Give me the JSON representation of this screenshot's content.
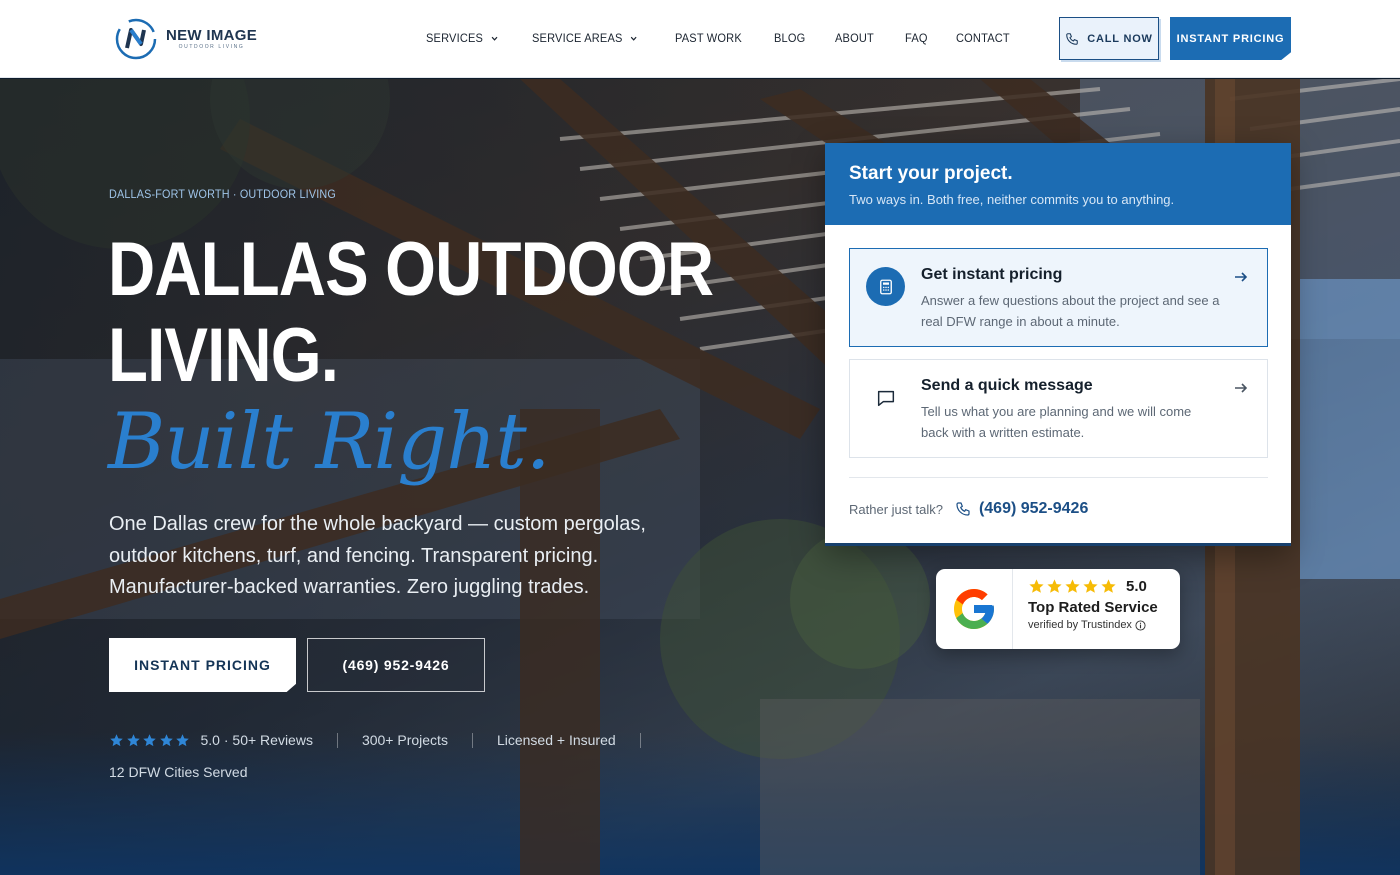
{
  "brand": {
    "name": "NEW IMAGE",
    "tagline": "OUTDOOR LIVING",
    "logo_letter": "N",
    "primary_color": "#1c6cb3",
    "dark_color": "#18416e"
  },
  "nav": {
    "items": [
      {
        "label": "SERVICES",
        "has_dropdown": true
      },
      {
        "label": "SERVICE AREAS",
        "has_dropdown": true
      },
      {
        "label": "PAST WORK",
        "has_dropdown": false
      },
      {
        "label": "BLOG",
        "has_dropdown": false
      },
      {
        "label": "ABOUT",
        "has_dropdown": false
      },
      {
        "label": "FAQ",
        "has_dropdown": false
      },
      {
        "label": "CONTACT",
        "has_dropdown": false
      }
    ],
    "call_button": "CALL NOW",
    "pricing_button": "INSTANT PRICING"
  },
  "hero": {
    "eyebrow": "DALLAS-FORT WORTH · OUTDOOR LIVING",
    "headline_line1": "DALLAS OUTDOOR",
    "headline_line2": "LIVING.",
    "headline_script": "Built Right.",
    "lede": "One Dallas crew for the whole backyard — custom pergolas, outdoor kitchens, turf, and fencing. Transparent pricing. Manufacturer-backed warranties. Zero juggling trades.",
    "primary_button": "INSTANT PRICING",
    "phone_button": "(469) 952-9426",
    "trust": {
      "rating_stars": 5,
      "rating_text": "5.0 · 50+ Reviews",
      "projects": "300+ Projects",
      "licensed": "Licensed + Insured",
      "cities": "12 DFW Cities Served"
    }
  },
  "card": {
    "title": "Start your project.",
    "subtitle": "Two ways in. Both free, neither commits you to anything.",
    "options": [
      {
        "title": "Get instant pricing",
        "description": "Answer a few questions about the project and see a real DFW range in about a minute.",
        "icon": "calculator-icon"
      },
      {
        "title": "Send a quick message",
        "description": "Tell us what you are planning and we will come back with a written estimate.",
        "icon": "chat-icon"
      }
    ],
    "talk_label": "Rather just talk?",
    "talk_phone": "(469) 952-9426"
  },
  "badge": {
    "score": "5.0",
    "stars": 5,
    "title": "Top Rated Service",
    "verified": "verified by Trustindex",
    "star_color": "#f6bb06"
  }
}
